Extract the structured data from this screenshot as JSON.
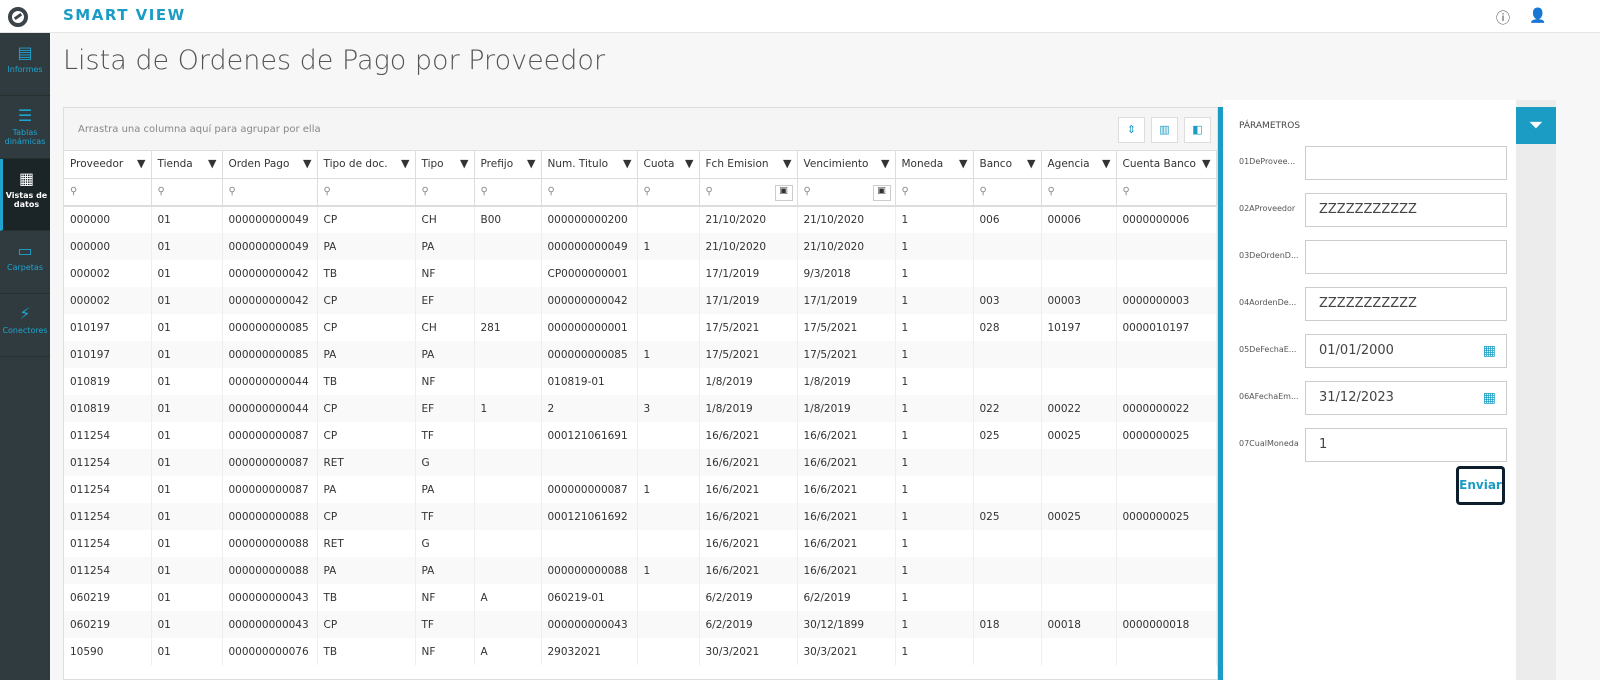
{
  "app": {
    "brand": "SMART VIEW",
    "info_icon": "info-icon",
    "user_icon": "user-icon"
  },
  "sidebar": {
    "items": [
      {
        "label": "Informes",
        "icon": "report-icon"
      },
      {
        "label": "Tablas dinámicas",
        "icon": "pivot-table-icon"
      },
      {
        "label": "Vistas de datos",
        "icon": "grid-icon",
        "active": true
      },
      {
        "label": "Carpetas",
        "icon": "folder-icon"
      },
      {
        "label": "Conectores",
        "icon": "plug-icon"
      }
    ]
  },
  "page": {
    "title": "Lista de Ordenes de Pago por Proveedor"
  },
  "grid": {
    "group_hint": "Arrastra una columna aquí para agrupar por ella",
    "columns": [
      "Proveedor",
      "Tienda",
      "Orden Pago",
      "Tipo de doc.",
      "Tipo",
      "Prefijo",
      "Num. Titulo",
      "Cuota",
      "Fch Emision",
      "Vencimiento",
      "Moneda",
      "Banco",
      "Agencia",
      "Cuenta Banco"
    ],
    "rows": [
      [
        "000000",
        "01",
        "000000000049",
        "CP",
        "CH",
        "B00",
        "000000000200",
        "",
        "21/10/2020",
        "21/10/2020",
        "1",
        "006",
        "00006",
        "0000000006"
      ],
      [
        "000000",
        "01",
        "000000000049",
        "PA",
        "PA",
        "",
        "000000000049",
        "1",
        "21/10/2020",
        "21/10/2020",
        "1",
        "",
        "",
        ""
      ],
      [
        "000002",
        "01",
        "000000000042",
        "TB",
        "NF",
        "",
        "CP0000000001",
        "",
        "17/1/2019",
        "9/3/2018",
        "1",
        "",
        "",
        ""
      ],
      [
        "000002",
        "01",
        "000000000042",
        "CP",
        "EF",
        "",
        "000000000042",
        "",
        "17/1/2019",
        "17/1/2019",
        "1",
        "003",
        "00003",
        "0000000003"
      ],
      [
        "010197",
        "01",
        "000000000085",
        "CP",
        "CH",
        "281",
        "000000000001",
        "",
        "17/5/2021",
        "17/5/2021",
        "1",
        "028",
        "10197",
        "0000010197"
      ],
      [
        "010197",
        "01",
        "000000000085",
        "PA",
        "PA",
        "",
        "000000000085",
        "1",
        "17/5/2021",
        "17/5/2021",
        "1",
        "",
        "",
        ""
      ],
      [
        "010819",
        "01",
        "000000000044",
        "TB",
        "NF",
        "",
        "010819-01",
        "",
        "1/8/2019",
        "1/8/2019",
        "1",
        "",
        "",
        ""
      ],
      [
        "010819",
        "01",
        "000000000044",
        "CP",
        "EF",
        "1",
        "2",
        "3",
        "1/8/2019",
        "1/8/2019",
        "1",
        "022",
        "00022",
        "0000000022"
      ],
      [
        "011254",
        "01",
        "000000000087",
        "CP",
        "TF",
        "",
        "000121061691",
        "",
        "16/6/2021",
        "16/6/2021",
        "1",
        "025",
        "00025",
        "0000000025"
      ],
      [
        "011254",
        "01",
        "000000000087",
        "RET",
        "G",
        "",
        "",
        "",
        "16/6/2021",
        "16/6/2021",
        "1",
        "",
        "",
        ""
      ],
      [
        "011254",
        "01",
        "000000000087",
        "PA",
        "PA",
        "",
        "000000000087",
        "1",
        "16/6/2021",
        "16/6/2021",
        "1",
        "",
        "",
        ""
      ],
      [
        "011254",
        "01",
        "000000000088",
        "CP",
        "TF",
        "",
        "000121061692",
        "",
        "16/6/2021",
        "16/6/2021",
        "1",
        "025",
        "00025",
        "0000000025"
      ],
      [
        "011254",
        "01",
        "000000000088",
        "RET",
        "G",
        "",
        "",
        "",
        "16/6/2021",
        "16/6/2021",
        "1",
        "",
        "",
        ""
      ],
      [
        "011254",
        "01",
        "000000000088",
        "PA",
        "PA",
        "",
        "000000000088",
        "1",
        "16/6/2021",
        "16/6/2021",
        "1",
        "",
        "",
        ""
      ],
      [
        "060219",
        "01",
        "000000000043",
        "TB",
        "NF",
        "A",
        "060219-01",
        "",
        "6/2/2019",
        "6/2/2019",
        "1",
        "",
        "",
        ""
      ],
      [
        "060219",
        "01",
        "000000000043",
        "CP",
        "TF",
        "",
        "000000000043",
        "",
        "6/2/2019",
        "30/12/1899",
        "1",
        "018",
        "00018",
        "0000000018"
      ],
      [
        "10590",
        "01",
        "000000000076",
        "TB",
        "NF",
        "A",
        "29032021",
        "",
        "30/3/2021",
        "30/3/2021",
        "1",
        "",
        "",
        ""
      ]
    ]
  },
  "params": {
    "title": "PÁRAMETROS",
    "fields": [
      {
        "label": "01DeProvee...",
        "value": ""
      },
      {
        "label": "02AProveedor",
        "value": "ZZZZZZZZZZZ"
      },
      {
        "label": "03DeOrdenD...",
        "value": ""
      },
      {
        "label": "04AordenDe...",
        "value": "ZZZZZZZZZZZ"
      },
      {
        "label": "05DeFechaE...",
        "value": "01/01/2000",
        "date": true
      },
      {
        "label": "06AFechaEm...",
        "value": "31/12/2023",
        "date": true
      },
      {
        "label": "07CualMoneda",
        "value": "1"
      }
    ],
    "submit": "Enviar"
  },
  "colors": {
    "accent": "#1a9cc4",
    "sidebar": "#2f3b3f"
  }
}
